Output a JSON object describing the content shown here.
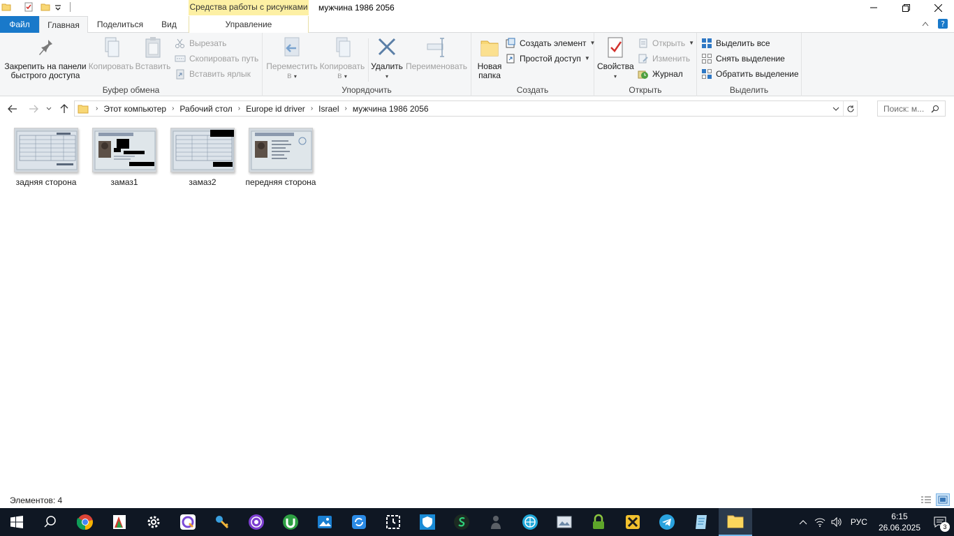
{
  "titlebar": {
    "context_tab_header": "Средства работы с рисунками",
    "title": "мужчина 1986 2056"
  },
  "tabs": {
    "file": "Файл",
    "home": "Главная",
    "share": "Поделиться",
    "view": "Вид",
    "manage": "Управление"
  },
  "ribbon": {
    "clipboard": {
      "label": "Буфер обмена",
      "pin": "Закрепить на панели быстрого доступа",
      "pin_line1": "Закрепить на панели",
      "pin_line2": "быстрого доступа",
      "copy": "Копировать",
      "paste": "Вставить",
      "cut": "Вырезать",
      "copy_path": "Скопировать путь",
      "paste_shortcut": "Вставить ярлык"
    },
    "organize": {
      "label": "Упорядочить",
      "move_line1": "Переместить",
      "move_line2": "в",
      "copyto_line1": "Копировать",
      "copyto_line2": "в",
      "delete": "Удалить",
      "rename": "Переименовать"
    },
    "new": {
      "label": "Создать",
      "new_folder_line1": "Новая",
      "new_folder_line2": "папка",
      "new_item": "Создать элемент",
      "easy_access": "Простой доступ"
    },
    "open": {
      "label": "Открыть",
      "properties": "Свойства",
      "open": "Открыть",
      "edit": "Изменить",
      "history": "Журнал"
    },
    "select": {
      "label": "Выделить",
      "select_all": "Выделить все",
      "select_none": "Снять выделение",
      "invert": "Обратить выделение"
    }
  },
  "address": {
    "crumbs": [
      "Этот компьютер",
      "Рабочий стол",
      "Europe id driver",
      "Israel",
      "мужчина 1986 2056"
    ],
    "search_placeholder": "Поиск: м..."
  },
  "files": [
    {
      "name": "задняя сторона",
      "kind": "back"
    },
    {
      "name": "замаз1",
      "kind": "front-redacted"
    },
    {
      "name": "замаз2",
      "kind": "back-redacted"
    },
    {
      "name": "передняя сторона",
      "kind": "front"
    }
  ],
  "status": {
    "count": "Элементов: 4"
  },
  "taskbar": {
    "lang": "РУС",
    "time": "6:15",
    "date": "26.06.2025",
    "notifications": "3"
  },
  "colors": {
    "file_tab": "#1979ca",
    "context_tab": "#fdf0a4",
    "taskbar": "#0f1723"
  }
}
